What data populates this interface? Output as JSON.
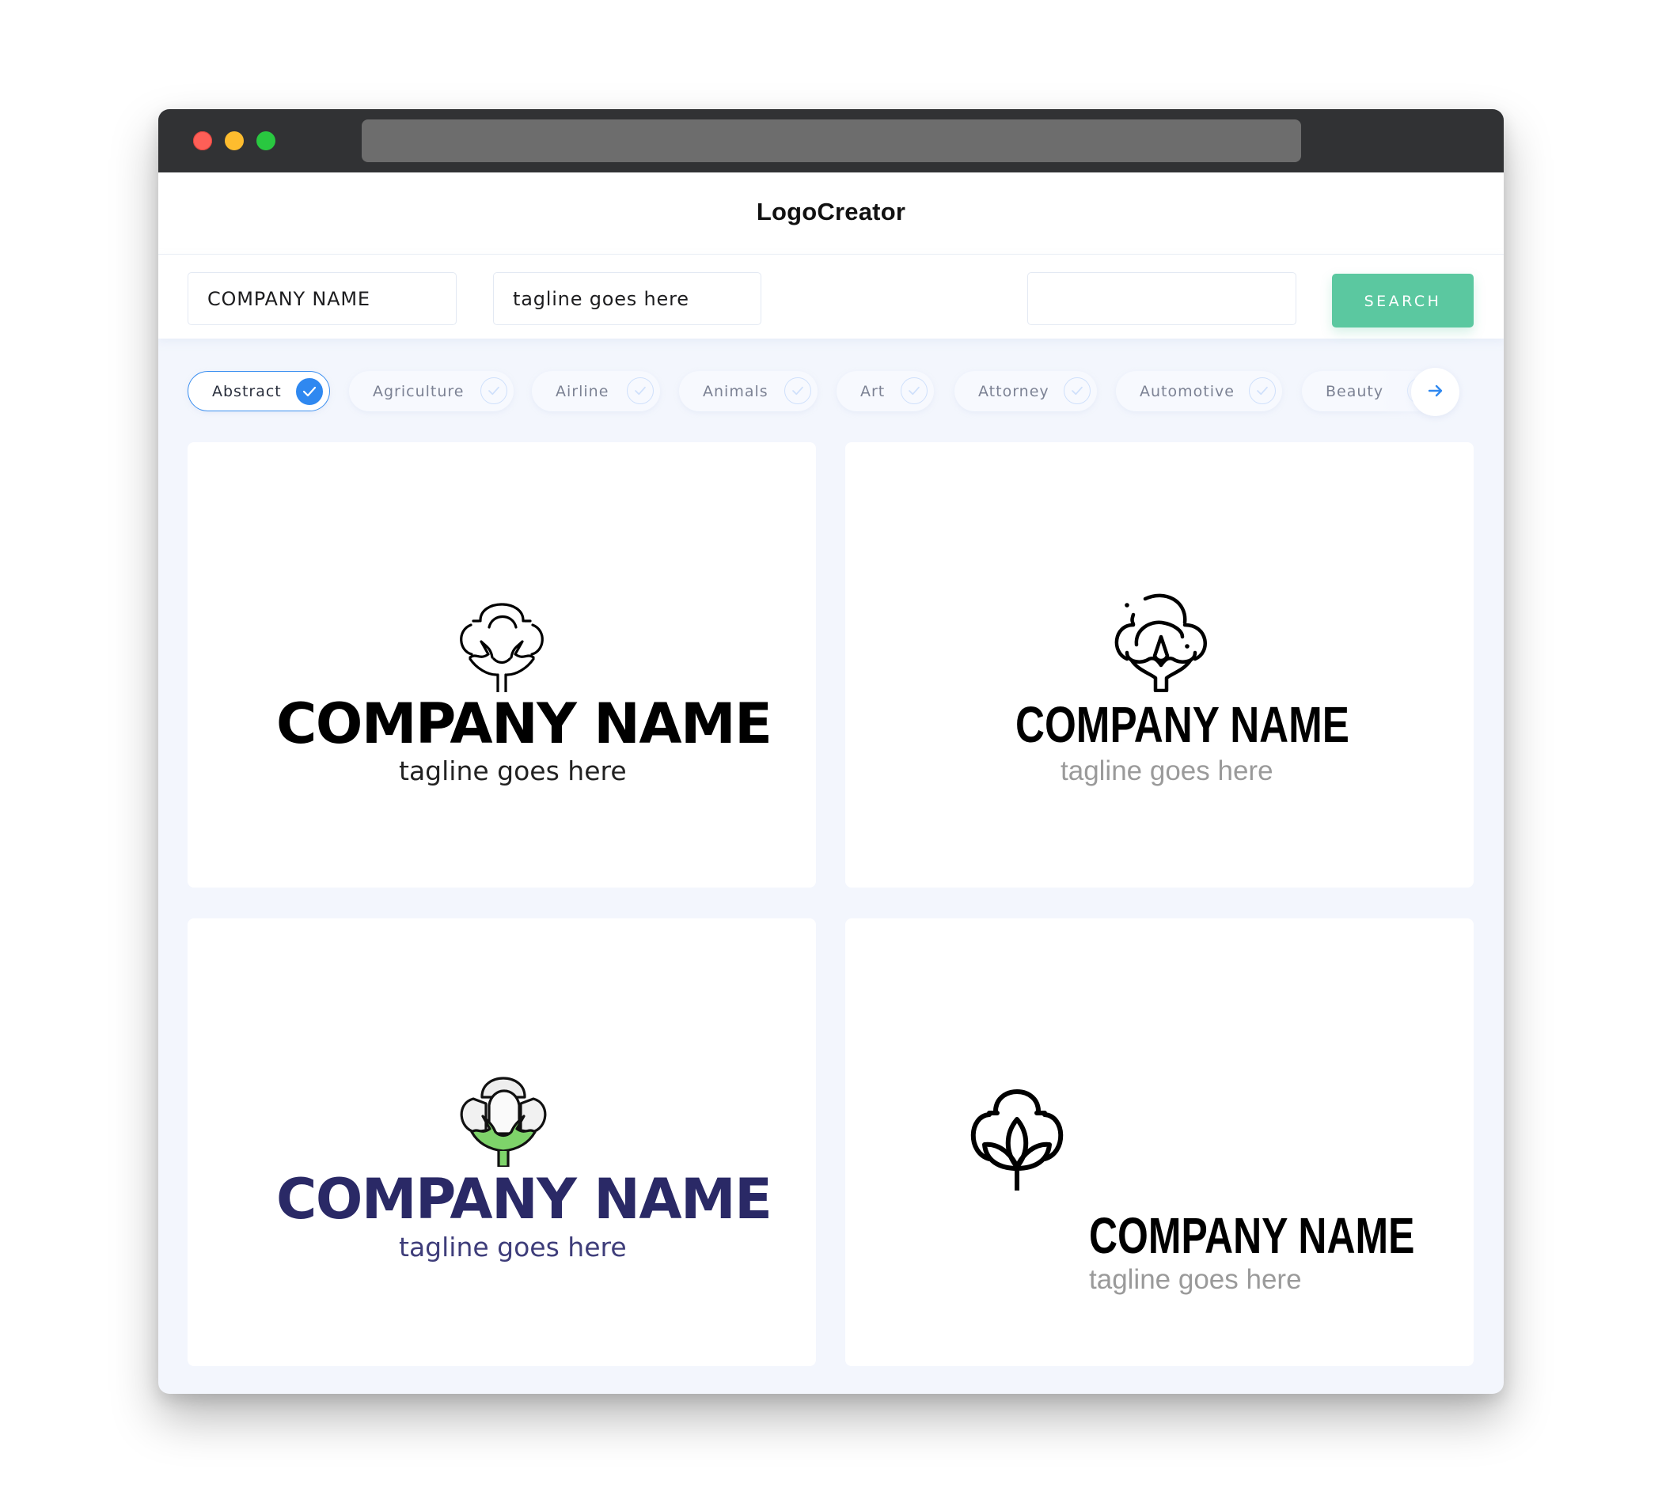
{
  "window": {
    "controls": [
      "close",
      "minimize",
      "maximize"
    ]
  },
  "header": {
    "brand": "LogoCreator"
  },
  "search": {
    "company_name_value": "COMPANY NAME",
    "tagline_value": "tagline goes here",
    "extra_value": "",
    "button_label": "SEARCH"
  },
  "categories": {
    "items": [
      {
        "label": "Abstract",
        "selected": true
      },
      {
        "label": "Agriculture",
        "selected": false
      },
      {
        "label": "Airline",
        "selected": false
      },
      {
        "label": "Animals",
        "selected": false
      },
      {
        "label": "Art",
        "selected": false
      },
      {
        "label": "Attorney",
        "selected": false
      },
      {
        "label": "Automotive",
        "selected": false
      },
      {
        "label": "Beauty",
        "selected": false
      }
    ],
    "next_icon": "arrow-right-icon"
  },
  "logos": [
    {
      "company": "COMPANY NAME",
      "tagline": "tagline goes here",
      "icon": "cotton-outline-icon",
      "text_color": "#000000",
      "tagline_color": "#222222"
    },
    {
      "company": "COMPANY NAME",
      "tagline": "tagline goes here",
      "icon": "cotton-line-icon",
      "text_color": "#000000",
      "tagline_color": "#9a9a9a"
    },
    {
      "company": "COMPANY NAME",
      "tagline": "tagline goes here",
      "icon": "cotton-color-icon",
      "text_color": "#2a2966",
      "tagline_color": "#3e3d7a"
    },
    {
      "company": "COMPANY NAME",
      "tagline": "tagline goes here",
      "icon": "cotton-bold-icon",
      "text_color": "#000000",
      "tagline_color": "#9a9a9a"
    }
  ],
  "colors": {
    "accent_blue": "#2f88f0",
    "search_green": "#5bc8a0",
    "navy": "#2a2966",
    "cotton_green": "#7ed36a"
  }
}
